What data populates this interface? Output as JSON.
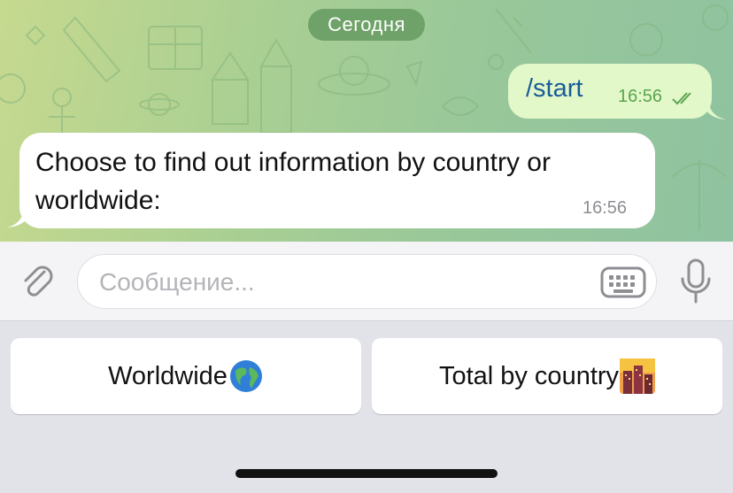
{
  "chat": {
    "date_chip": "Сегодня",
    "outgoing": {
      "text": "/start",
      "time": "16:56",
      "status": "read-double-check"
    },
    "incoming": {
      "text": "Choose to find out information by country or worldwide:",
      "time": "16:56"
    }
  },
  "composer": {
    "placeholder": "Сообщение...",
    "icons": [
      "paperclip-icon",
      "keyboard-icon",
      "microphone-icon"
    ]
  },
  "reply_keyboard": {
    "buttons": [
      {
        "label": "Worldwide",
        "icon": "globe-emoji-icon"
      },
      {
        "label": "Total by country",
        "icon": "city-dusk-emoji-icon"
      }
    ]
  },
  "colors": {
    "wallpaper_start": "#c6d98f",
    "wallpaper_end": "#8fc2a0",
    "date_chip": "#6fa268",
    "outgoing_bubble": "#e3f8c9",
    "outgoing_text": "#1b5b9a",
    "outgoing_time": "#5aa450",
    "incoming_bubble": "#ffffff",
    "keyboard_bg": "#e2e3e8"
  }
}
